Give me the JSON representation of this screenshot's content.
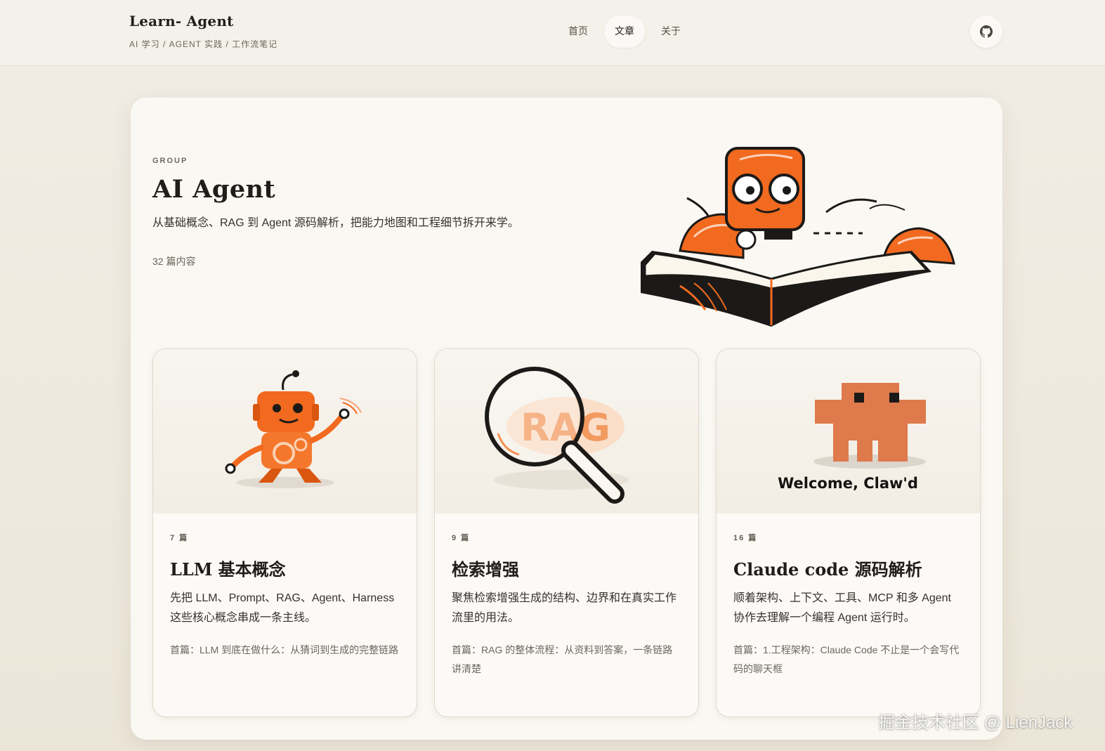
{
  "header": {
    "brand_title": "Learn- Agent",
    "brand_subtitle": "AI 学习 / AGENT 实践 / 工作流笔记",
    "nav": [
      {
        "label": "首页",
        "active": false
      },
      {
        "label": "文章",
        "active": true
      },
      {
        "label": "关于",
        "active": false
      }
    ],
    "github_icon": "github-icon"
  },
  "group": {
    "eyebrow": "GROUP",
    "title": "AI Agent",
    "description": "从基础概念、RAG 到 Agent 源码解析，把能力地图和工程细节拆开来学。",
    "count": "32 篇内容",
    "illustration": "robot-reading-book"
  },
  "cards": [
    {
      "count": "7 篇",
      "title": "LLM 基本概念",
      "description": "先把 LLM、Prompt、RAG、Agent、Harness 这些核心概念串成一条主线。",
      "first": "首篇：LLM 到底在做什么：从猜词到生成的完整链路",
      "illustration": "waving-robot"
    },
    {
      "count": "9 篇",
      "title": "检索增强",
      "description": "聚焦检索增强生成的结构、边界和在真实工作流里的用法。",
      "first": "首篇：RAG 的整体流程：从资料到答案，一条链路讲清楚",
      "illustration_text": "RAG",
      "illustration": "magnifier"
    },
    {
      "count": "16 篇",
      "title": "Claude code 源码解析",
      "description": "顺着架构、上下文、工具、MCP 和多 Agent 协作去理解一个编程 Agent 运行时。",
      "first": "首篇：1.工程架构：Claude Code 不止是一个会写代码的聊天框",
      "illustration_text": "Welcome, Claw'd",
      "illustration": "pixel-mascot"
    }
  ],
  "watermark": "掘金技术社区 @ LienJack",
  "colors": {
    "accent": "#f26a1f",
    "background": "#efeadf",
    "panel": "#faf8f3"
  }
}
